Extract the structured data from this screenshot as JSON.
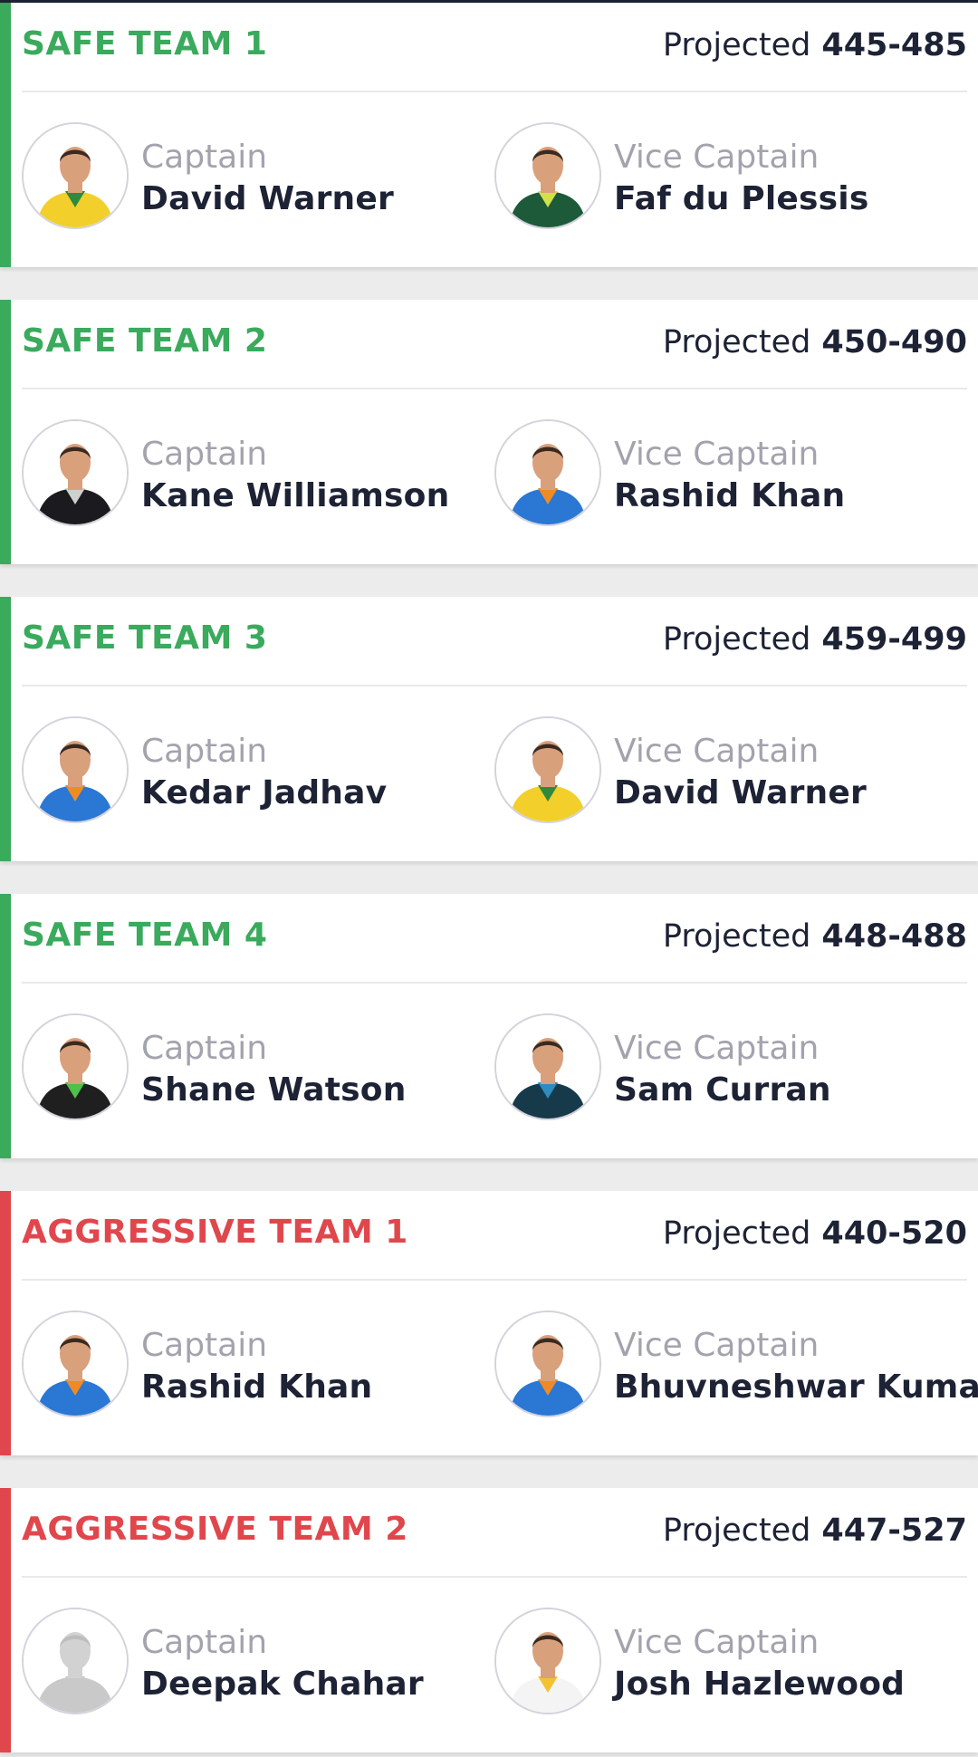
{
  "colors": {
    "safe": "#3aaa5c",
    "aggressive": "#e0474c",
    "text_dark": "#1d2235",
    "text_muted": "#a3a3ae"
  },
  "labels": {
    "projected": "Projected",
    "captain": "Captain",
    "vice_captain": "Vice Captain"
  },
  "teams": [
    {
      "title": "SAFE TEAM 1",
      "kind": "safe",
      "range": "445-485",
      "captain": {
        "name": "David Warner",
        "photo": "player-photo-yellow-kit"
      },
      "vice_captain": {
        "name": "Faf du Plessis",
        "photo": "player-photo-green-kit"
      }
    },
    {
      "title": "SAFE TEAM 2",
      "kind": "safe",
      "range": "450-490",
      "captain": {
        "name": "Kane Williamson",
        "photo": "player-photo-black-kit"
      },
      "vice_captain": {
        "name": "Rashid Khan",
        "photo": "player-photo-blue-kit"
      }
    },
    {
      "title": "SAFE TEAM 3",
      "kind": "safe",
      "range": "459-499",
      "captain": {
        "name": "Kedar Jadhav",
        "photo": "player-photo-blue-kit"
      },
      "vice_captain": {
        "name": "David Warner",
        "photo": "player-photo-yellow-kit"
      }
    },
    {
      "title": "SAFE TEAM 4",
      "kind": "safe",
      "range": "448-488",
      "captain": {
        "name": "Shane Watson",
        "photo": "player-photo-green-black-kit"
      },
      "vice_captain": {
        "name": "Sam Curran",
        "photo": "player-photo-navy-kit"
      }
    },
    {
      "title": "AGGRESSIVE TEAM 1",
      "kind": "aggressive",
      "range": "440-520",
      "captain": {
        "name": "Rashid Khan",
        "photo": "player-photo-blue-kit"
      },
      "vice_captain": {
        "name": "Bhuvneshwar Kumar",
        "photo": "player-photo-blue-kit"
      }
    },
    {
      "title": "AGGRESSIVE TEAM 2",
      "kind": "aggressive",
      "range": "447-527",
      "captain": {
        "name": "Deepak Chahar",
        "photo": "player-photo-placeholder"
      },
      "vice_captain": {
        "name": "Josh Hazlewood",
        "photo": "player-photo-white-kit"
      }
    }
  ]
}
